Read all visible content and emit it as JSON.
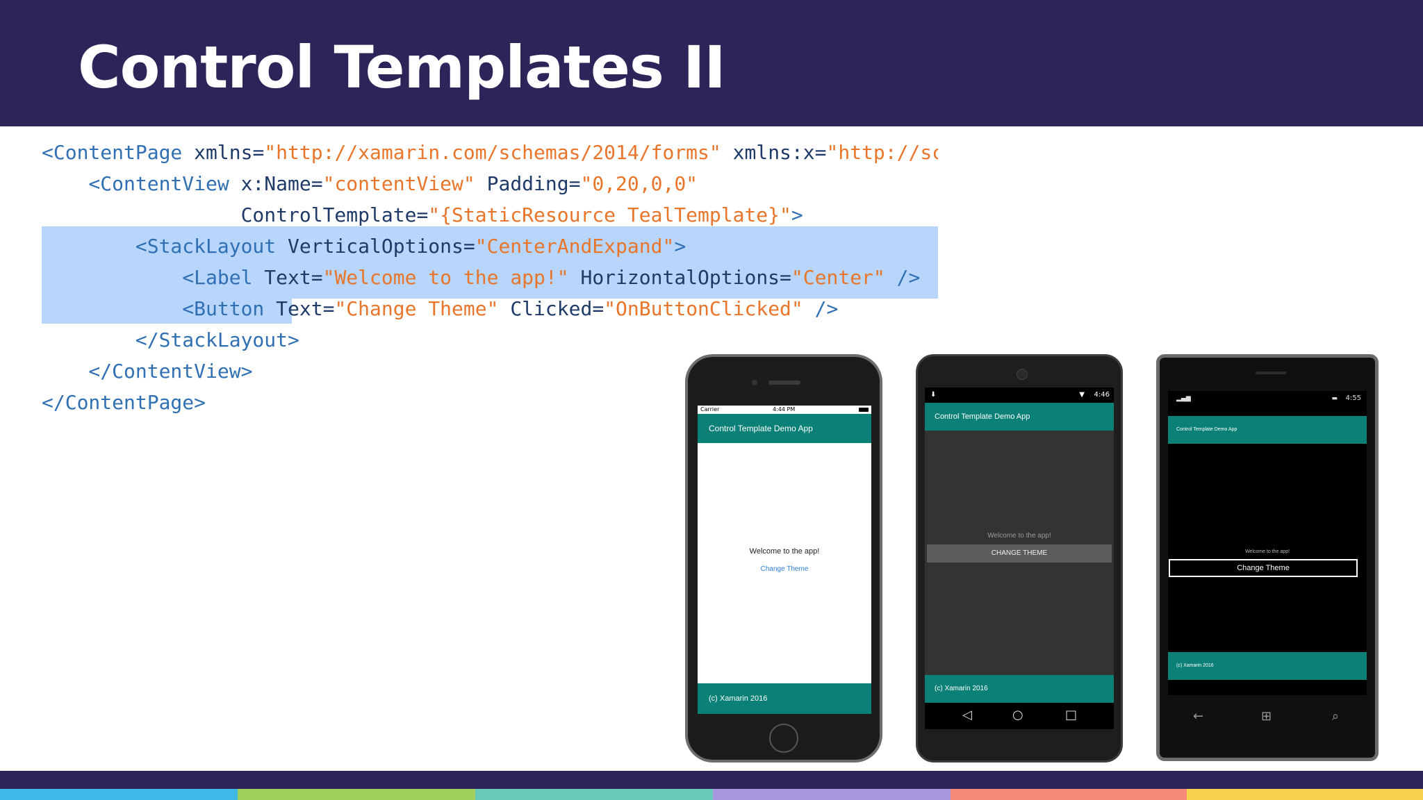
{
  "slide": {
    "title": "Control Templates II"
  },
  "code": {
    "lines": [
      [
        {
          "c": "tag",
          "t": "<ContentPage "
        },
        {
          "c": "attr",
          "t": "xmlns="
        },
        {
          "c": "str",
          "t": "\"http://xamarin.com/schemas/2014/forms\""
        },
        {
          "c": "attr",
          "t": " xmlns:x="
        },
        {
          "c": "str",
          "t": "\"http://sche"
        }
      ],
      [
        {
          "c": "tag",
          "t": "    <ContentView "
        },
        {
          "c": "attr",
          "t": "x:Name="
        },
        {
          "c": "str",
          "t": "\"contentView\""
        },
        {
          "c": "attr",
          "t": " Padding="
        },
        {
          "c": "str",
          "t": "\"0,20,0,0\""
        }
      ],
      [
        {
          "c": "attr",
          "t": "                 ControlTemplate="
        },
        {
          "c": "str",
          "t": "\"{StaticResource TealTemplate}\""
        },
        {
          "c": "tag",
          "t": ">"
        }
      ],
      [
        {
          "c": "tag",
          "t": "        <StackLayout "
        },
        {
          "c": "attr",
          "t": "VerticalOptions="
        },
        {
          "c": "str",
          "t": "\"CenterAndExpand\""
        },
        {
          "c": "tag",
          "t": ">"
        }
      ],
      [
        {
          "c": "tag",
          "t": "            <Label "
        },
        {
          "c": "attr",
          "t": "Text="
        },
        {
          "c": "str",
          "t": "\"Welcome to the app!\""
        },
        {
          "c": "attr",
          "t": " HorizontalOptions="
        },
        {
          "c": "str",
          "t": "\"Center\""
        },
        {
          "c": "tag",
          "t": " />"
        }
      ],
      [
        {
          "c": "tag",
          "t": "            <Button "
        },
        {
          "c": "attr",
          "t": "Text="
        },
        {
          "c": "str",
          "t": "\"Change Theme\""
        },
        {
          "c": "attr",
          "t": " Clicked="
        },
        {
          "c": "str",
          "t": "\"OnButtonClicked\""
        },
        {
          "c": "tag",
          "t": " />"
        }
      ],
      [
        {
          "c": "tag",
          "t": "        </StackLayout>"
        }
      ],
      [
        {
          "c": "tag",
          "t": "    </ContentView>"
        }
      ],
      [
        {
          "c": "tag",
          "t": "</ContentPage>"
        }
      ]
    ]
  },
  "phones": {
    "ios": {
      "carrier": "Carrier",
      "time": "4:44 PM",
      "app_title": "Control Template Demo App",
      "label": "Welcome to the app!",
      "button": "Change Theme",
      "footer": "(c) Xamarin 2016"
    },
    "android": {
      "time": "4:46",
      "app_title": "Control Template Demo App",
      "label": "Welcome to the app!",
      "button": "CHANGE THEME",
      "footer": "(c) Xamarin 2016"
    },
    "windows": {
      "time": "4:55",
      "app_title": "Control Template Demo App",
      "label": "Welcome to the app!",
      "button": "Change Theme",
      "footer": "(c) Xamarin 2016"
    }
  },
  "colors": {
    "header": "#2e245a",
    "teal": "#0a8076",
    "highlight": "#b8d6fb",
    "stripes": [
      "#3fb8e8",
      "#9fce5a",
      "#67c9b7",
      "#a896dc",
      "#f58b78",
      "#f6d24f"
    ]
  }
}
